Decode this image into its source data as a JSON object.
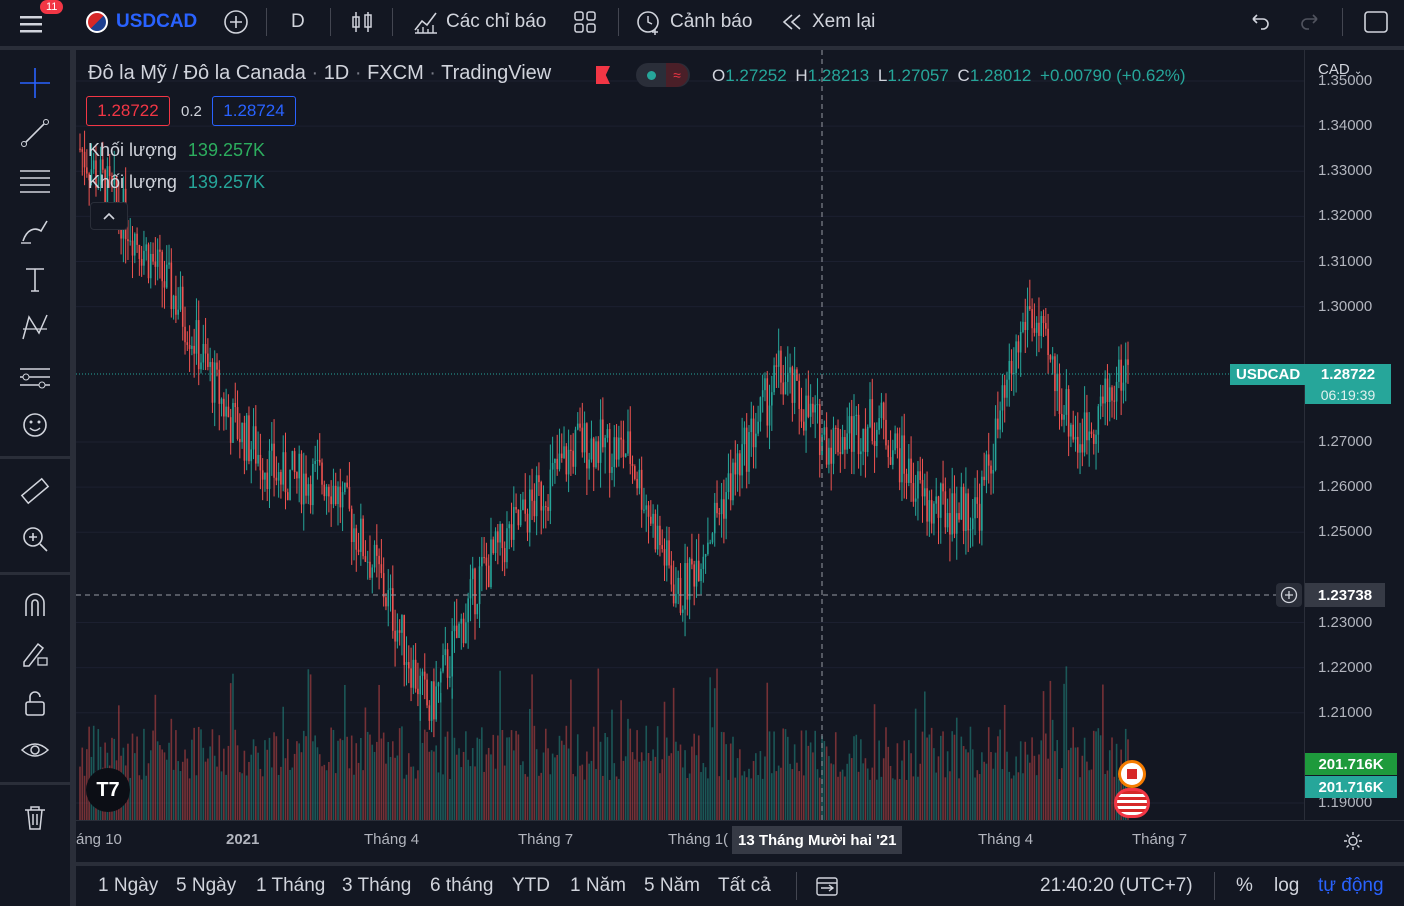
{
  "topbar": {
    "notif_count": "11",
    "symbol": "USDCAD",
    "interval": "D",
    "indicators_label": "Các chỉ báo",
    "alerts_label": "Cảnh báo",
    "replay_label": "Xem lại"
  },
  "legend": {
    "title": "Đô la Mỹ / Đô la Canada",
    "interval": "1D",
    "exchange": "FXCM",
    "source": "TradingView",
    "o_label": "O",
    "o": "1.27252",
    "h_label": "H",
    "h": "1.28213",
    "l_label": "L",
    "l": "1.27057",
    "c_label": "C",
    "c": "1.28012",
    "change": "+0.00790 (+0.62%)",
    "sell_price": "1.28722",
    "spread": "0.2",
    "buy_price": "1.28724",
    "vol1_label": "Khối lượng",
    "vol1_value": "139.257K",
    "vol2_label": "Khối lượng",
    "vol2_value": "139.257K"
  },
  "price_axis": {
    "currency": "CAD",
    "ticks": [
      "1.35000",
      "1.34000",
      "1.33000",
      "1.32000",
      "1.31000",
      "1.30000",
      "1.27000",
      "1.26000",
      "1.25000",
      "1.23000",
      "1.22000",
      "1.21000",
      "1.19000"
    ],
    "last_symbol": "USDCAD",
    "last_price": "1.28722",
    "countdown": "06:19:39",
    "crosshair_price": "1.23738",
    "volume_tag1": "201.716K",
    "volume_tag2": "201.716K"
  },
  "time_axis": {
    "labels": [
      "áng 10",
      "2021",
      "Tháng 4",
      "Tháng 7",
      "Tháng 1(",
      "Tháng 4",
      "Tháng 7"
    ],
    "crosshair_date": "13 Tháng Mười hai '21"
  },
  "bottombar": {
    "ranges": [
      "1 Ngày",
      "5 Ngày",
      "1 Tháng",
      "3 Tháng",
      "6 tháng",
      "YTD",
      "1 Năm",
      "5 Năm",
      "Tất cả"
    ],
    "clock": "21:40:20 (UTC+7)",
    "percent": "%",
    "log": "log",
    "auto": "tự động"
  },
  "colors": {
    "up": "#26a69a",
    "down": "#ef5350",
    "accent": "#2962ff",
    "bg": "#131722"
  },
  "chart_data": {
    "type": "candlestick",
    "symbol": "USDCAD",
    "interval": "1D",
    "ylim": [
      1.19,
      1.35
    ],
    "key_points": [
      {
        "x": "2020-09",
        "y": 1.335
      },
      {
        "x": "2020-10",
        "y": 1.318
      },
      {
        "x": "2020-11",
        "y": 1.3
      },
      {
        "x": "2021-01",
        "y": 1.275
      },
      {
        "x": "2021-02",
        "y": 1.262
      },
      {
        "x": "2021-03",
        "y": 1.262
      },
      {
        "x": "2021-04",
        "y": 1.24
      },
      {
        "x": "2021-05",
        "y": 1.21
      },
      {
        "x": "2021-06",
        "y": 1.24
      },
      {
        "x": "2021-07",
        "y": 1.255
      },
      {
        "x": "2021-08",
        "y": 1.27
      },
      {
        "x": "2021-09",
        "y": 1.268
      },
      {
        "x": "2021-10",
        "y": 1.235
      },
      {
        "x": "2021-11",
        "y": 1.26
      },
      {
        "x": "2021-12",
        "y": 1.285
      },
      {
        "x": "2022-01",
        "y": 1.27
      },
      {
        "x": "2022-02",
        "y": 1.275
      },
      {
        "x": "2022-03",
        "y": 1.255
      },
      {
        "x": "2022-04",
        "y": 1.255
      },
      {
        "x": "2022-05",
        "y": 1.3
      },
      {
        "x": "2022-06",
        "y": 1.27
      },
      {
        "x": "2022-07",
        "y": 1.287
      }
    ]
  }
}
